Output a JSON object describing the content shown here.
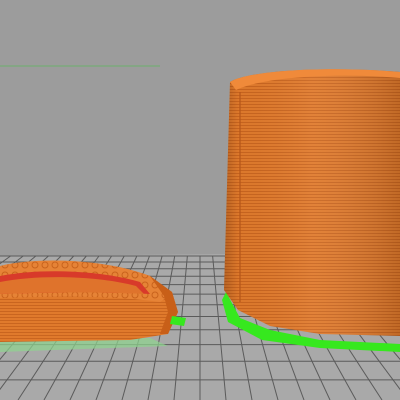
{
  "viewport": {
    "kind": "3d-slicer-preview",
    "colors": {
      "background": "#9c9c9c",
      "bed_surface": "#a4a4a4",
      "bed_grid": "#5f5f5f",
      "perimeter": "#e07a2c",
      "perimeter_shadow": "#c85f18",
      "perimeter_highlight": "#f08a3a",
      "support_skirt": "#36e81e",
      "inner_wall": "#d83a2a",
      "axis_line": "#3ec23e"
    },
    "objects": [
      {
        "name": "left-tray-object",
        "feature": "perimeter"
      },
      {
        "name": "right-cylinder-object",
        "feature": "perimeter"
      }
    ]
  }
}
